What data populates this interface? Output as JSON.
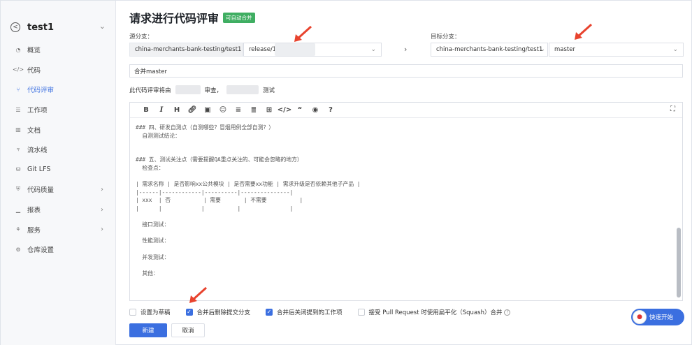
{
  "sidebar": {
    "repo_name": "test1",
    "items": [
      {
        "label": "概览",
        "icon": "gauge-icon"
      },
      {
        "label": "代码",
        "icon": "code-icon"
      },
      {
        "label": "代码评审",
        "icon": "pull-request-icon",
        "active": true
      },
      {
        "label": "工作项",
        "icon": "list-icon"
      },
      {
        "label": "文档",
        "icon": "book-icon"
      },
      {
        "label": "流水线",
        "icon": "pipeline-icon"
      },
      {
        "label": "Git LFS",
        "icon": "database-icon"
      },
      {
        "label": "代码质量",
        "icon": "shield-icon",
        "has_arrow": true
      },
      {
        "label": "报表",
        "icon": "chart-icon",
        "has_arrow": true
      },
      {
        "label": "服务",
        "icon": "service-icon",
        "has_arrow": true
      },
      {
        "label": "仓库设置",
        "icon": "gear-icon"
      }
    ]
  },
  "header": {
    "title": "请求进行代码评审",
    "badge": "可自动合并"
  },
  "source": {
    "label": "源分支：",
    "repo": "china-merchants-bank-testing/test1",
    "branch": "release/1"
  },
  "target": {
    "label": "目标分支：",
    "repo": "china-merchants-bank-testing/test1",
    "branch": "master"
  },
  "pr_title": "合并master",
  "reviewer_text": {
    "prefix": "此代码评审将由",
    "middle": "审查，",
    "suffix": "测试"
  },
  "editor": {
    "content": "### 四、研发自测点（自测哪些？冒烟用例全部自测？）\n  自测测试结论：\n\n\n### 五、测试关注点（需要提醒QA重点关注的、可能会忽略的地方）\n  检查点：\n\n| 需求名称 | 是否影响xx公共模块 | 是否需要xx功能 | 需求升级是否依赖其他子产品 |\n|------|------------|----------|---------------|\n| xxx  | 否          | 需要       | 不需要          |\n|      |            |          |               |\n\n  接口测试：\n\n  性能测试：\n\n  并发测试：\n\n  其他："
  },
  "options": [
    {
      "label": "设置为草稿",
      "checked": false
    },
    {
      "label": "合并后删除提交分支",
      "checked": true
    },
    {
      "label": "合并后关闭提到的工作项",
      "checked": true
    },
    {
      "label": "接受 Pull Request 时使用扁平化（Squash）合并",
      "checked": false,
      "help": true
    }
  ],
  "buttons": {
    "create": "新建",
    "cancel": "取消"
  },
  "quick_start": "快速开始",
  "colors": {
    "primary": "#3b6fe0",
    "badge": "#3fae62",
    "annotation": "#e8432e"
  }
}
